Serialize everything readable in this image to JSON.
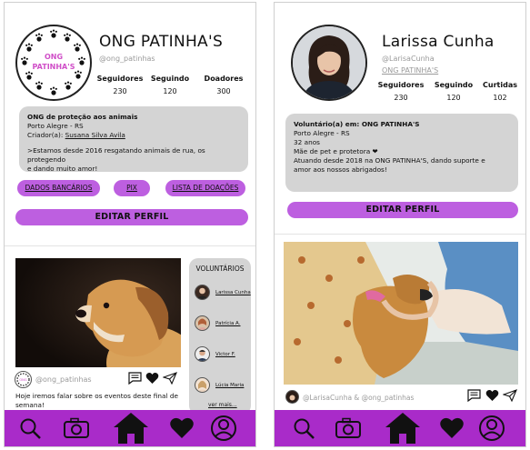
{
  "ong": {
    "name": "ONG PATINHA'S",
    "handle": "@ong_patinhas",
    "logo_text_1": "ONG",
    "logo_text_2": "PATINHA'S",
    "stats": [
      {
        "label": "Seguidores",
        "value": "230"
      },
      {
        "label": "Seguindo",
        "value": "120"
      },
      {
        "label": "Doadores",
        "value": "300"
      }
    ],
    "bio": {
      "line1": "ONG de proteção aos animais",
      "line2": "Porto Alegre - RS",
      "creator_prefix": "Criador(a): ",
      "creator_link": "Susana Silva Avila",
      "line4": ">Estamos desde 2016 resgatando animais de rua, os protegendo",
      "line5": "e dando muito amor!"
    },
    "buttons": {
      "bank": "DADOS BANCÁRIOS",
      "pix": "PIX",
      "donations": "LISTA DE DOAÇÕES",
      "edit": "EDITAR PERFIL"
    },
    "post": {
      "handle": "@ong_patinhas",
      "caption_1": "Hoje iremos falar sobre os eventos deste final de",
      "caption_2": "semana!"
    },
    "volunteers": {
      "title": "VOLUNTÁRIOS",
      "items": [
        "Larissa Cunha",
        "Patrícia A.",
        "Victor F.",
        "Lúcia Maria"
      ],
      "more": "ver mais..."
    }
  },
  "user": {
    "name": "Larissa Cunha",
    "handle": "@LarisaCunha",
    "org_link": "ONG PATINHA'S",
    "stats": [
      {
        "label": "Seguidores",
        "value": "230"
      },
      {
        "label": "Seguindo",
        "value": "120"
      },
      {
        "label": "Curtidas",
        "value": "102"
      }
    ],
    "bio": {
      "line1": "Voluntário(a) em: ONG PATINHA'S",
      "line2": "Porto Alegre - RS",
      "line3": "32 anos",
      "line4": "Mãe de pet e protetora ❤",
      "line5": "Atuando desde 2018 na ONG PATINHA'S, dando suporte e",
      "line6": "amor aos nossos abrigados!"
    },
    "edit": "EDITAR PERFIL",
    "post": {
      "handle": "@LarisaCunha & @ong_patinhas"
    }
  },
  "colors": {
    "accent": "#bd5fe0",
    "nav": "#a92bc9",
    "card": "#d4d4d4"
  },
  "icons": [
    "search-icon",
    "camera-icon",
    "home-icon",
    "heart-icon",
    "profile-icon",
    "comment-icon",
    "share-icon"
  ]
}
